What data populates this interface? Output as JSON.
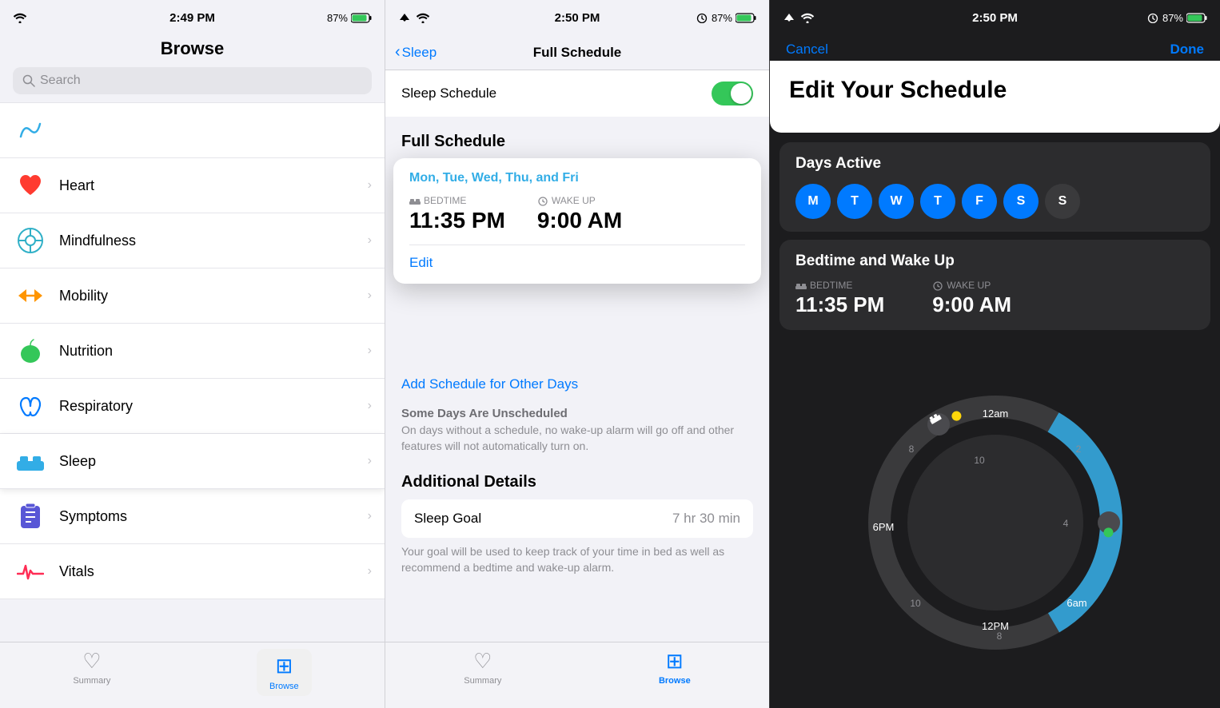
{
  "panel1": {
    "status": {
      "time": "2:49 PM",
      "battery": "87%"
    },
    "title": "Browse",
    "search_placeholder": "Search",
    "items": [
      {
        "id": "heart",
        "label": "Heart",
        "icon": "❤️",
        "icon_bg": "#ff3b30"
      },
      {
        "id": "mindfulness",
        "label": "Mindfulness",
        "icon": "🌐",
        "icon_bg": "#30b0c7"
      },
      {
        "id": "mobility",
        "label": "Mobility",
        "icon": "⇄",
        "icon_bg": "#ff9500"
      },
      {
        "id": "nutrition",
        "label": "Nutrition",
        "icon": "🍎",
        "icon_bg": "#34c759"
      },
      {
        "id": "respiratory",
        "label": "Respiratory",
        "icon": "🫁",
        "icon_bg": "#007aff"
      },
      {
        "id": "sleep",
        "label": "Sleep",
        "icon": "🛏",
        "icon_bg": "#32ade6",
        "selected": true
      },
      {
        "id": "symptoms",
        "label": "Symptoms",
        "icon": "📋",
        "icon_bg": "#5856d6"
      },
      {
        "id": "vitals",
        "label": "Vitals",
        "icon": "📈",
        "icon_bg": "#ff2d55"
      }
    ],
    "tabs": [
      {
        "id": "summary",
        "label": "Summary",
        "icon": "♡",
        "active": false
      },
      {
        "id": "browse",
        "label": "Browse",
        "icon": "⊞",
        "active": true
      }
    ]
  },
  "panel2": {
    "status": {
      "time": "2:50 PM",
      "battery": "87%"
    },
    "back_label": "Sleep",
    "title": "Full Schedule",
    "sleep_schedule_label": "Sleep Schedule",
    "section_header": "Full Schedule",
    "card": {
      "days": "Mon, Tue, Wed, Thu, and Fri",
      "bedtime_label": "BEDTIME",
      "bedtime_value": "11:35 PM",
      "wakeup_label": "WAKE UP",
      "wakeup_value": "9:00 AM",
      "edit_label": "Edit"
    },
    "add_schedule": "Add Schedule for Other Days",
    "unscheduled_title": "Some Days Are Unscheduled",
    "unscheduled_desc": "On days without a schedule, no wake-up alarm will go off and other features will not automatically turn on.",
    "additional_header": "Additional Details",
    "sleep_goal_label": "Sleep Goal",
    "sleep_goal_value": "7 hr 30 min",
    "sleep_goal_note": "Your goal will be used to keep track of your time in bed as well as recommend a bedtime and wake-up alarm.",
    "tabs": [
      {
        "id": "summary",
        "label": "Summary",
        "icon": "♡",
        "active": false
      },
      {
        "id": "browse",
        "label": "Browse",
        "icon": "⊞",
        "active": true
      }
    ]
  },
  "panel3": {
    "status": {
      "time": "2:50 PM",
      "battery": "87%"
    },
    "cancel_label": "Cancel",
    "done_label": "Done",
    "title": "Edit Your Schedule",
    "days_active_label": "Days Active",
    "days": [
      {
        "id": "M",
        "label": "M",
        "active": true
      },
      {
        "id": "T1",
        "label": "T",
        "active": true
      },
      {
        "id": "W",
        "label": "W",
        "active": true
      },
      {
        "id": "T2",
        "label": "T",
        "active": true
      },
      {
        "id": "F",
        "label": "F",
        "active": true
      },
      {
        "id": "S1",
        "label": "S",
        "active": true
      },
      {
        "id": "S2",
        "label": "S",
        "active": false
      }
    ],
    "bedtime_wake_label": "Bedtime and Wake Up",
    "bedtime_label": "BEDTIME",
    "bedtime_value": "11:35 PM",
    "wakeup_label": "WAKE UP",
    "wakeup_value": "9:00 AM",
    "clock": {
      "labels": [
        "12am",
        "2",
        "4",
        "6am",
        "8",
        "10",
        "12PM",
        "2",
        "4",
        "6PM",
        "8",
        "10"
      ],
      "bedtime_angle": 330,
      "wakeup_angle": 90
    }
  }
}
